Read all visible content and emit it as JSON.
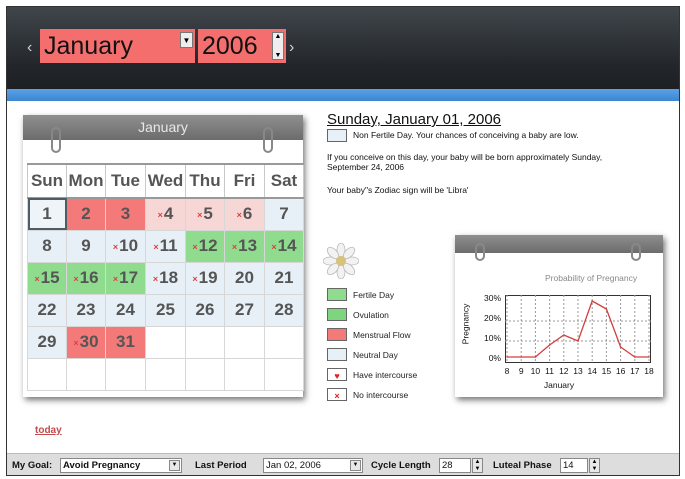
{
  "header": {
    "prev": "‹",
    "next": "›",
    "month": "January",
    "year": "2006"
  },
  "calendar": {
    "title": "January",
    "weekdays": [
      "Sun",
      "Mon",
      "Tue",
      "Wed",
      "Thu",
      "Fri",
      "Sat"
    ],
    "rows": [
      [
        {
          "d": "1",
          "t": "today"
        },
        {
          "d": "2",
          "t": "menstrual"
        },
        {
          "d": "3",
          "t": "menstrual"
        },
        {
          "d": "4",
          "t": "light",
          "x": true
        },
        {
          "d": "5",
          "t": "light",
          "x": true
        },
        {
          "d": "6",
          "t": "light",
          "x": true
        },
        {
          "d": "7",
          "t": "neutral"
        }
      ],
      [
        {
          "d": "8",
          "t": "neutral"
        },
        {
          "d": "9",
          "t": "neutral"
        },
        {
          "d": "10",
          "t": "neutral",
          "x": true
        },
        {
          "d": "11",
          "t": "neutral",
          "x": true
        },
        {
          "d": "12",
          "t": "fertile",
          "x": true
        },
        {
          "d": "13",
          "t": "fertile",
          "x": true
        },
        {
          "d": "14",
          "t": "fertile",
          "x": true
        }
      ],
      [
        {
          "d": "15",
          "t": "fertile",
          "x": true
        },
        {
          "d": "16",
          "t": "fertile",
          "x": true
        },
        {
          "d": "17",
          "t": "fertile",
          "x": true
        },
        {
          "d": "18",
          "t": "neutral",
          "x": true
        },
        {
          "d": "19",
          "t": "neutral",
          "x": true
        },
        {
          "d": "20",
          "t": "neutral"
        },
        {
          "d": "21",
          "t": "neutral"
        }
      ],
      [
        {
          "d": "22",
          "t": "neutral"
        },
        {
          "d": "23",
          "t": "neutral"
        },
        {
          "d": "24",
          "t": "neutral"
        },
        {
          "d": "25",
          "t": "neutral"
        },
        {
          "d": "26",
          "t": "neutral"
        },
        {
          "d": "27",
          "t": "neutral"
        },
        {
          "d": "28",
          "t": "neutral"
        }
      ],
      [
        {
          "d": "29",
          "t": "neutral"
        },
        {
          "d": "30",
          "t": "menstrual",
          "x": true
        },
        {
          "d": "31",
          "t": "menstrual"
        },
        {
          "d": "",
          "t": "empty"
        },
        {
          "d": "",
          "t": "empty"
        },
        {
          "d": "",
          "t": "empty"
        },
        {
          "d": "",
          "t": "empty"
        }
      ],
      [
        {
          "d": "",
          "t": "empty"
        },
        {
          "d": "",
          "t": "empty"
        },
        {
          "d": "",
          "t": "empty"
        },
        {
          "d": "",
          "t": "empty"
        },
        {
          "d": "",
          "t": "empty"
        },
        {
          "d": "",
          "t": "empty"
        },
        {
          "d": "",
          "t": "empty"
        }
      ]
    ],
    "today_link": "today"
  },
  "info": {
    "date_heading": "Sunday, January 01, 2006",
    "day_type": "Non Fertile Day. Your chances of conceiving a baby are low.",
    "birth_line1": "If you conceive on this day, your baby will be born approximately Sunday,",
    "birth_line2": "September 24, 2006",
    "zodiac": "Your baby\"s Zodiac sign will be 'Libra'"
  },
  "legend": {
    "fertile": "Fertile Day",
    "ovulation": "Ovulation",
    "menstrual": "Menstrual Flow",
    "neutral": "Neutral Day",
    "intercourse": "Have intercourse",
    "no_intercourse": "No intercourse"
  },
  "colors": {
    "fertile": "#8fdc8f",
    "ovulation": "#7fd47f",
    "menstrual": "#f47a7a",
    "neutral": "#e6f0f6"
  },
  "chart_data": {
    "type": "line",
    "title": "Probability of Pregnancy",
    "xlabel": "January",
    "ylabel": "Pregnancy",
    "x": [
      8,
      9,
      10,
      11,
      12,
      13,
      14,
      15,
      16,
      17,
      18
    ],
    "y": [
      2,
      2,
      2,
      8,
      13,
      10,
      30,
      26,
      7,
      2,
      2
    ],
    "ylim": [
      0,
      30
    ],
    "yticks": [
      "30%",
      "20%",
      "10%",
      "0%"
    ],
    "grid": true,
    "color": "#d04040"
  },
  "bottom": {
    "goal_label": "My Goal:",
    "goal_value": "Avoid Pregnancy",
    "last_period_label": "Last Period",
    "last_period_value": "Jan 02, 2006",
    "cycle_label": "Cycle Length",
    "cycle_value": "28",
    "luteal_label": "Luteal Phase",
    "luteal_value": "14"
  }
}
